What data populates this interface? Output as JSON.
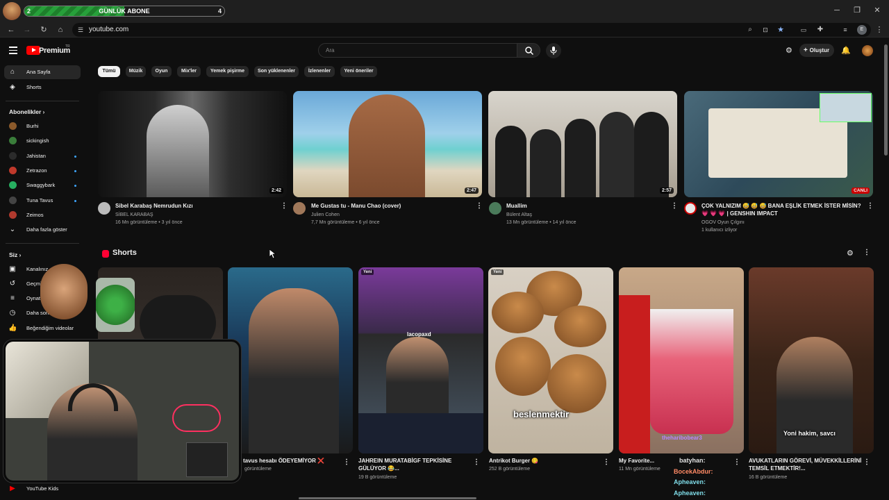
{
  "overlay": {
    "sub_goal_label": "GÜNLÜK ABONE",
    "sub_current": "2",
    "sub_target": "4",
    "sub_progress": 0.5
  },
  "browser": {
    "url": "youtube.com"
  },
  "header": {
    "logo_text": "Premium",
    "country_code": "TR",
    "search_placeholder": "Ara",
    "create_label": "Oluştur"
  },
  "sidebar": {
    "main_items": [
      {
        "label": "Ana Sayfa",
        "icon": "home-icon"
      },
      {
        "label": "Shorts",
        "icon": "shorts-icon"
      }
    ],
    "subscriptions_header": "Abonelikler",
    "subscriptions": [
      {
        "label": "Burhi",
        "color": "#8b5a2b",
        "live": false
      },
      {
        "label": "sickingish",
        "color": "#3a7d3a",
        "live": false
      },
      {
        "label": "Jahistan",
        "color": "#2b2b2b",
        "live": true
      },
      {
        "label": "Zetrazon",
        "color": "#c0392b",
        "live": true
      },
      {
        "label": "Swaggybark",
        "color": "#27ae60",
        "live": true
      },
      {
        "label": "Tuna Tavus",
        "color": "#444",
        "live": true
      },
      {
        "label": "Zeimos",
        "color": "#b03a2e",
        "live": false
      }
    ],
    "show_more": "Daha fazla göster",
    "you_header": "Siz",
    "you_items": [
      {
        "label": "Kanalınız"
      },
      {
        "label": "Geçmiş"
      },
      {
        "label": "Oynatma"
      },
      {
        "label": "Daha sonra"
      },
      {
        "label": "Beğendiğim videolar"
      }
    ],
    "kids_label": "YouTube Kids"
  },
  "chips": [
    "Tümü",
    "Müzik",
    "Oyun",
    "Mix'ler",
    "Yemek pişirme",
    "Son yüklenenler",
    "İzlenenler",
    "Yeni öneriler"
  ],
  "videos": [
    {
      "title": "Sibel Karabaş Nemrudun Kızı",
      "title2": "",
      "channel": "SİBEL KARABAŞ",
      "meta": "16 Mn görüntüleme • 3 yıl önce",
      "duration": "2:42",
      "live": false
    },
    {
      "title": "Me Gustas tu - Manu Chao (cover)",
      "title2": "",
      "channel": "Julien Cohen",
      "meta": "7,7 Mn görüntüleme • 6 yıl önce",
      "duration": "2:47",
      "live": false
    },
    {
      "title": "Muallim",
      "title2": "",
      "channel": "Bülent Altaş",
      "meta": "13 Mn görüntüleme • 14 yıl önce",
      "duration": "2:57",
      "live": false
    },
    {
      "title": "ÇOK YALNIZIM 😅 😅 😅 BANA EŞLİK ETMEK İSTER MİSİN?",
      "title2": "💗 💗 💗 | GENSHIN IMPACT",
      "channel": "OGOV Oyun Çılgını",
      "meta": "1 kullanıcı izliyor",
      "duration": "CANLI",
      "live": true
    }
  ],
  "shorts_header": "Shorts",
  "shorts": [
    {
      "title": "",
      "title2": "",
      "meta": "",
      "badge": "",
      "caption": ""
    },
    {
      "title": "tavus hesabı ÖDEYEMİYOR ❌",
      "title2": "",
      "meta": "görüntüleme",
      "badge": "",
      "caption": ""
    },
    {
      "title": "JAHREIN MURATABİGF TEPKİSİNE",
      "title2": "GÜLÜYOR 😂...",
      "meta": "19 B görüntüleme",
      "badge": "Yeni",
      "caption": ""
    },
    {
      "title": "Antrikot Burger 😋",
      "title2": "",
      "meta": "252 B görüntüleme",
      "badge": "Yeni",
      "caption": "beslenmektir"
    },
    {
      "title": "My Favorite...",
      "title2": "",
      "meta": "11 Mn görüntüleme",
      "badge": "",
      "caption": ""
    },
    {
      "title": "AVUKATLARIN GÖREVİ, MÜVEKKİLLERİNİ",
      "title2": "TEMSİL ETMEKTİR!...",
      "meta": "16 B görüntüleme",
      "badge": "",
      "caption": "Yoni hakim, savcı"
    }
  ],
  "stream_text": {
    "webcam_name": "lacopaxd",
    "chat": [
      {
        "user": "theharibobear3",
        "color": "#b388ff"
      },
      {
        "user": "batyhan:",
        "color": "#e0e0e0"
      },
      {
        "user": "BocekAbdur:",
        "color": "#ff8a65"
      },
      {
        "user": "Apheaven:",
        "color": "#80deea"
      },
      {
        "user": "Apheaven:",
        "color": "#80deea"
      }
    ]
  }
}
